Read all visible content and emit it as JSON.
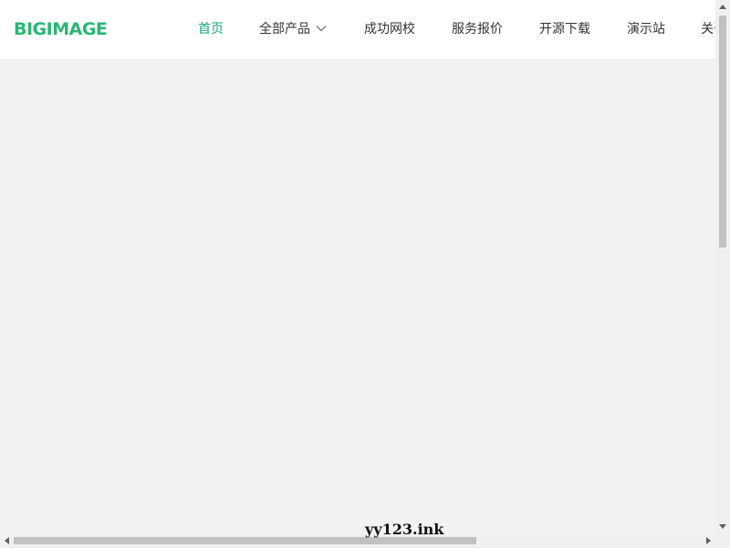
{
  "header": {
    "logo_text": "BIGIMAGE",
    "nav": [
      {
        "label": "首页",
        "active": true
      },
      {
        "label": "全部产品",
        "has_dropdown": true
      },
      {
        "label": "成功网校"
      },
      {
        "label": "服务报价"
      },
      {
        "label": "开源下载"
      },
      {
        "label": "演示站"
      },
      {
        "label": "关于"
      }
    ]
  },
  "watermark": "yy123.ink",
  "colors": {
    "brand_green": "#2bb673",
    "active_nav": "#1aa37a",
    "page_background": "#f2f2f2",
    "header_background": "#ffffff",
    "scroll_thumb": "#c1c1c1"
  },
  "icons": [
    "chevron-down-icon",
    "scroll-up-arrow-icon",
    "scroll-down-arrow-icon",
    "scroll-left-arrow-icon",
    "scroll-right-arrow-icon"
  ]
}
